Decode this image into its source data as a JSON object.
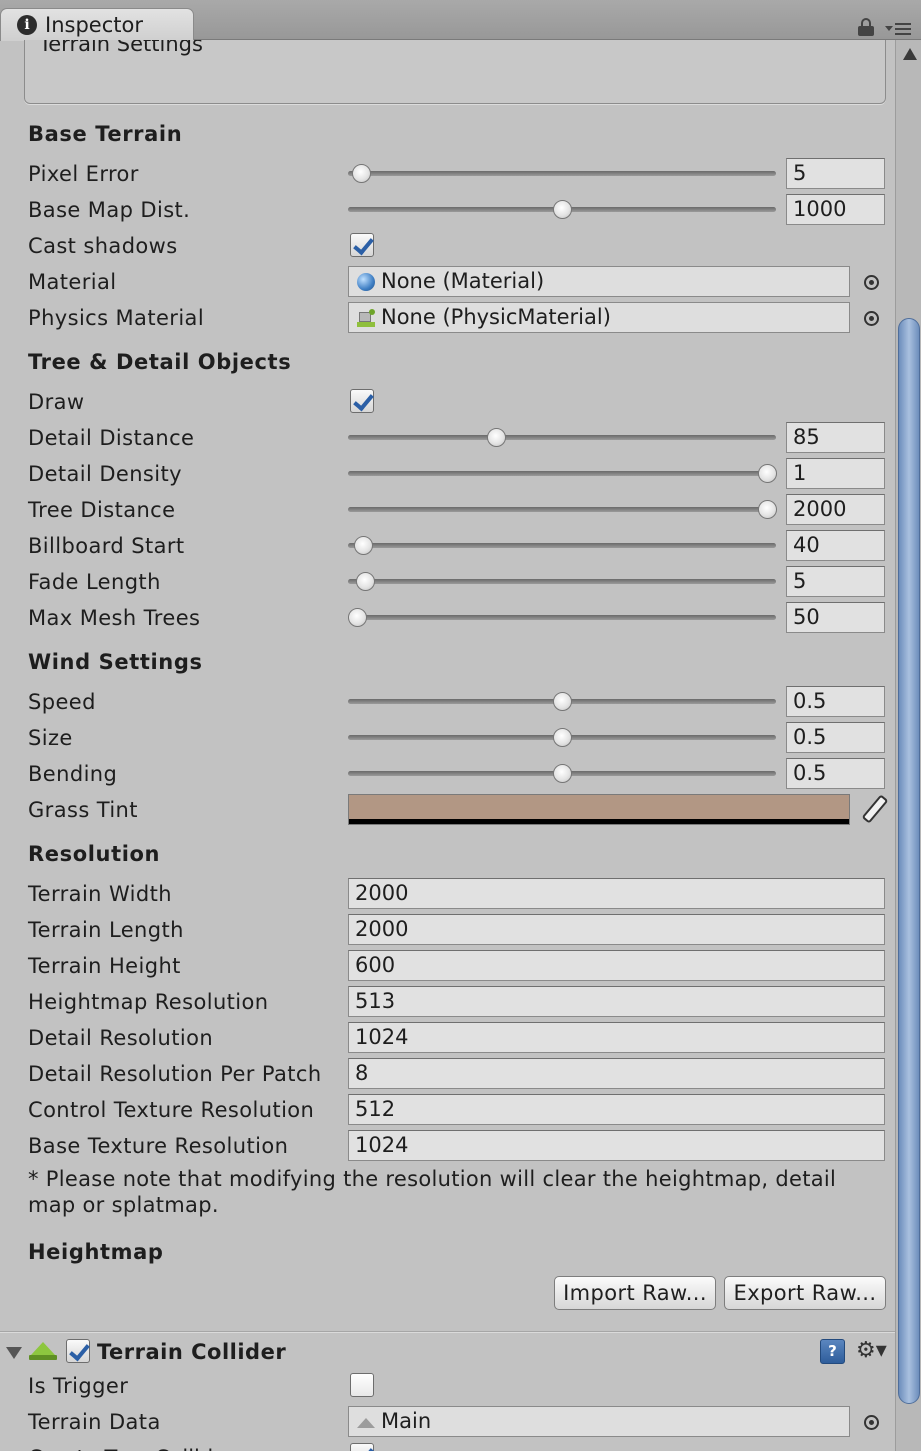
{
  "window": {
    "tab_title": "Inspector"
  },
  "terrain_settings_label": "Terrain Settings",
  "base_terrain": {
    "header": "Base Terrain",
    "pixel_error": {
      "label": "Pixel Error",
      "value": "5",
      "slider_fraction": 0.03
    },
    "base_map_dist": {
      "label": "Base Map Dist.",
      "value": "1000",
      "slider_fraction": 0.5
    },
    "cast_shadows": {
      "label": "Cast shadows",
      "checked": true
    },
    "material": {
      "label": "Material",
      "value": "None (Material)"
    },
    "physics_material": {
      "label": "Physics Material",
      "value": "None (PhysicMaterial)"
    }
  },
  "tree_detail": {
    "header": "Tree & Detail Objects",
    "draw": {
      "label": "Draw",
      "checked": true
    },
    "detail_distance": {
      "label": "Detail Distance",
      "value": "85",
      "slider_fraction": 0.345
    },
    "detail_density": {
      "label": "Detail Density",
      "value": "1",
      "slider_fraction": 0.98
    },
    "tree_distance": {
      "label": "Tree Distance",
      "value": "2000",
      "slider_fraction": 0.98
    },
    "billboard_start": {
      "label": "Billboard Start",
      "value": "40",
      "slider_fraction": 0.035
    },
    "fade_length": {
      "label": "Fade Length",
      "value": "5",
      "slider_fraction": 0.04
    },
    "max_mesh_trees": {
      "label": "Max Mesh Trees",
      "value": "50",
      "slider_fraction": 0.02
    }
  },
  "wind_settings": {
    "header": "Wind Settings",
    "speed": {
      "label": "Speed",
      "value": "0.5",
      "slider_fraction": 0.5
    },
    "size": {
      "label": "Size",
      "value": "0.5",
      "slider_fraction": 0.5
    },
    "bending": {
      "label": "Bending",
      "value": "0.5",
      "slider_fraction": 0.5
    },
    "grass_tint": {
      "label": "Grass Tint",
      "color": "#b29784"
    }
  },
  "resolution": {
    "header": "Resolution",
    "terrain_width": {
      "label": "Terrain Width",
      "value": "2000"
    },
    "terrain_length": {
      "label": "Terrain Length",
      "value": "2000"
    },
    "terrain_height": {
      "label": "Terrain Height",
      "value": "600"
    },
    "heightmap_resolution": {
      "label": "Heightmap Resolution",
      "value": "513"
    },
    "detail_resolution": {
      "label": "Detail Resolution",
      "value": "1024"
    },
    "detail_resolution_per_patch": {
      "label": "Detail Resolution Per Patch",
      "value": "8"
    },
    "control_texture_resolution": {
      "label": "Control Texture Resolution",
      "value": "512"
    },
    "base_texture_resolution": {
      "label": "Base Texture Resolution",
      "value": "1024"
    },
    "note": "* Please note that modifying the resolution will clear the heightmap, detail map or splatmap."
  },
  "heightmap": {
    "header": "Heightmap",
    "import_label": "Import Raw...",
    "export_label": "Export Raw..."
  },
  "terrain_collider": {
    "title": "Terrain Collider",
    "enabled": true,
    "is_trigger": {
      "label": "Is Trigger",
      "checked": false
    },
    "terrain_data": {
      "label": "Terrain Data",
      "value": "Main"
    },
    "clipped_label": "Create Tree Colliders"
  },
  "icons": {
    "info": "info-icon",
    "lock": "lock-icon",
    "menu": "menu-icon",
    "object_picker": "object-picker-icon",
    "eyedropper": "eyedropper-icon",
    "help": "help-icon",
    "gear": "gear-icon"
  },
  "colors": {
    "panel_background": "#c2c2c2",
    "checkmark_accent": "#2b5fa6",
    "scrollbar_thumb": "#8aa6cf"
  }
}
